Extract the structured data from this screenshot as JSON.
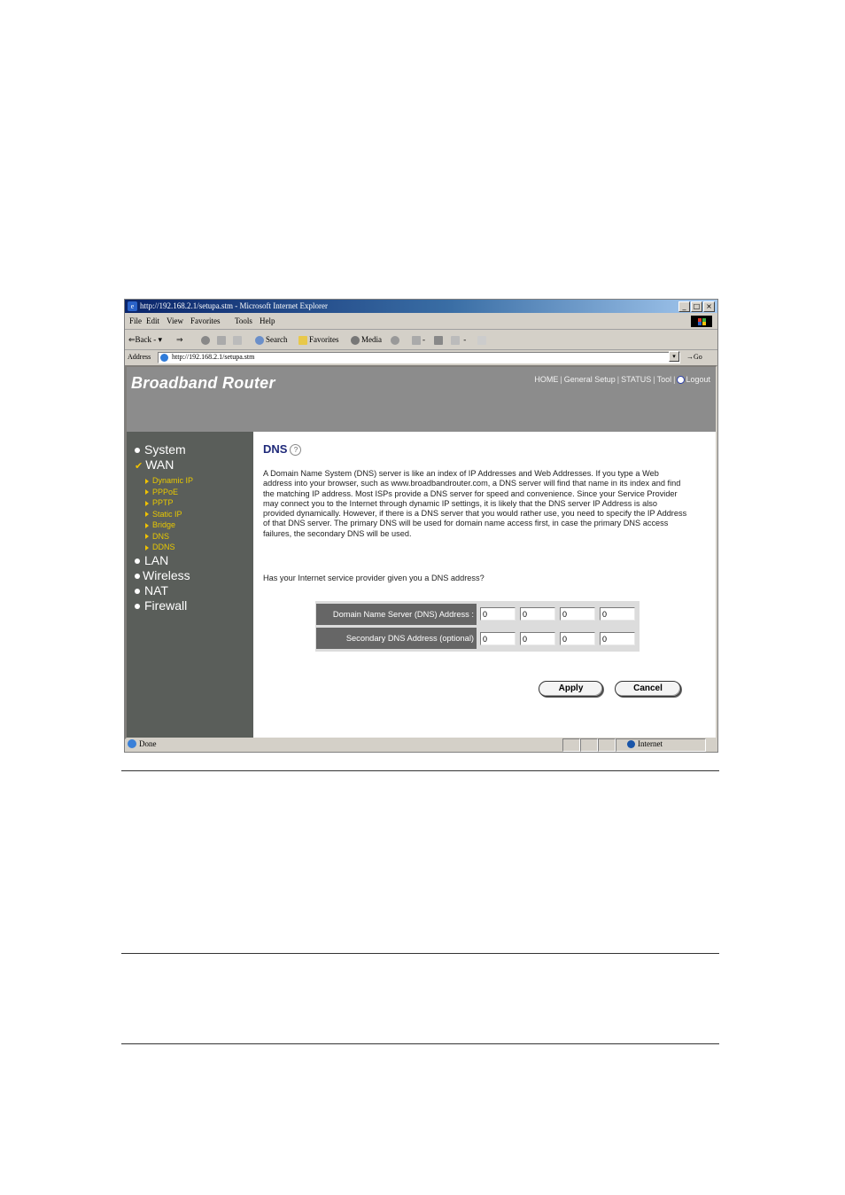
{
  "browser": {
    "window_title": "http://192.168.2.1/setupa.stm - Microsoft Internet Explorer",
    "window_buttons": [
      "_",
      "□",
      "×"
    ],
    "menu": [
      "File",
      "Edit",
      "View",
      "Favorites",
      "Tools",
      "Help"
    ],
    "toolbar": {
      "back": "⇐Back",
      "back_arrow": "▾",
      "forward": "⇒",
      "search": "Search",
      "favorites": "Favorites",
      "media": "Media"
    },
    "address_label": "Address",
    "address_url": "http://192.168.2.1/setupa.stm",
    "go_label": "Go",
    "status_text": "Done",
    "zone_text": "Internet"
  },
  "router": {
    "brand": "Broadband Router",
    "top_nav": [
      "HOME",
      "General Setup",
      "STATUS",
      "Tool",
      "Logout"
    ],
    "sidebar": {
      "items": [
        "System",
        "WAN",
        "LAN",
        "Wireless",
        "NAT",
        "Firewall"
      ],
      "wan_sub": [
        "Dynamic IP",
        "PPPoE",
        "PPTP",
        "Static IP",
        "Bridge",
        "DNS",
        "DDNS"
      ]
    },
    "content": {
      "title": "DNS",
      "help_icon": "?",
      "description": "A Domain Name System (DNS) server is like an index of IP Addresses and Web Addresses. If you type a Web address into your browser, such as www.broadbandrouter.com, a DNS server will find that name in its index and find the matching IP address. Most ISPs provide a DNS server for speed and convenience. Since your Service Provider may connect you to the Internet through dynamic IP settings, it is likely that the DNS server IP Address is also provided dynamically. However, if there is a DNS server that you would rather use, you need to specify the IP Address of that DNS server. The primary DNS will be used for domain name access first, in case the primary DNS access failures, the secondary DNS will be used.",
      "question": "Has your Internet service provider given you a DNS address?",
      "primary_label": "Domain Name Server (DNS) Address :",
      "secondary_label": "Secondary DNS Address (optional)",
      "primary_octets": [
        "0",
        "0",
        "0",
        "0"
      ],
      "secondary_octets": [
        "0",
        "0",
        "0",
        "0"
      ],
      "apply": "Apply",
      "cancel": "Cancel"
    }
  },
  "colors": {
    "banner": "#8c8c8c",
    "sidebar": "#5a5e5a",
    "sub_menu": "#e8c800",
    "title": "#1f2a7a",
    "label_bg": "#666666"
  }
}
